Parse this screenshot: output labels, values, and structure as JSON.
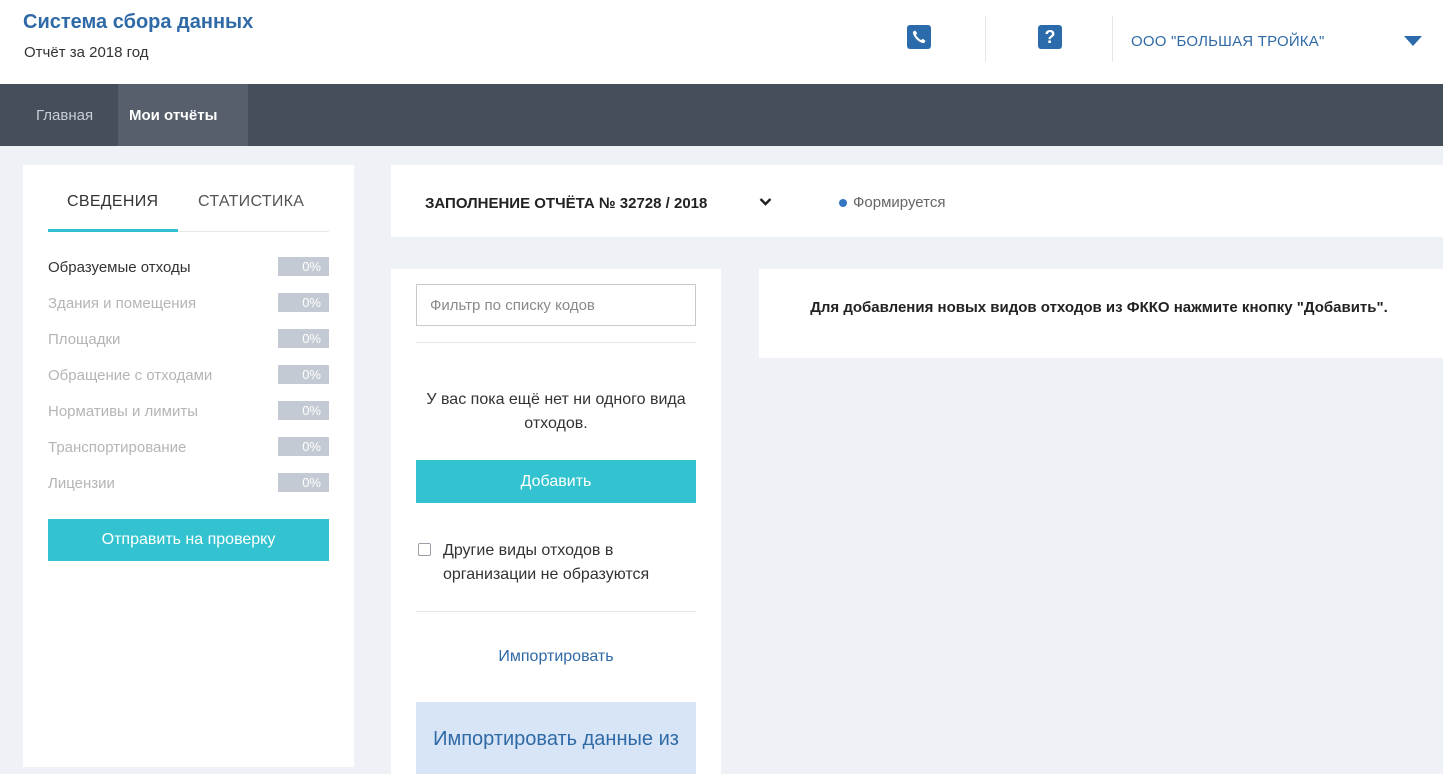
{
  "header": {
    "app_title": "Система сбора данных",
    "subtitle": "Отчёт за 2018 год",
    "phone_icon": "phone-icon",
    "help_icon": "help-icon",
    "help_glyph": "?",
    "org_name": "ООО \"БОЛЬШАЯ ТРОЙКА\"",
    "accent_color": "#2c6bab"
  },
  "nav": {
    "items": [
      {
        "label": "Главная",
        "active": false
      },
      {
        "label": "Мои отчёты",
        "active": true
      }
    ]
  },
  "left": {
    "tabs": [
      {
        "label": "СВЕДЕНИЯ",
        "active": true
      },
      {
        "label": "СТАТИСТИКА",
        "active": false
      }
    ],
    "sections": [
      {
        "label": "Образуемые отходы",
        "percent": "0%",
        "active": true
      },
      {
        "label": "Здания и помещения",
        "percent": "0%",
        "active": false
      },
      {
        "label": "Площадки",
        "percent": "0%",
        "active": false
      },
      {
        "label": "Обращение с отходами",
        "percent": "0%",
        "active": false
      },
      {
        "label": "Нормативы и лимиты",
        "percent": "0%",
        "active": false
      },
      {
        "label": "Транспортирование",
        "percent": "0%",
        "active": false
      },
      {
        "label": "Лицензии",
        "percent": "0%",
        "active": false
      }
    ],
    "send_button": "Отправить на проверку",
    "button_color": "#33c3d0"
  },
  "report": {
    "title": "ЗАПОЛНЕНИЕ ОТЧЁТА № 32728 / 2018",
    "chevron": "❯",
    "status": "Формируется",
    "status_color": "#3575c4"
  },
  "middle": {
    "filter_placeholder": "Фильтр по списку кодов",
    "filter_value": "",
    "empty_message": "У вас пока ещё нет ни одного вида отходов.",
    "add_button": "Добавить",
    "checkbox_label": "Другие виды отходов в организации не образуются",
    "checkbox_checked": false,
    "import_link": "Импортировать",
    "import_box_text": "Импортировать данные из"
  },
  "info": {
    "text": "Для добавления новых видов отходов из ФККО нажмите кнопку \"Добавить\"."
  }
}
